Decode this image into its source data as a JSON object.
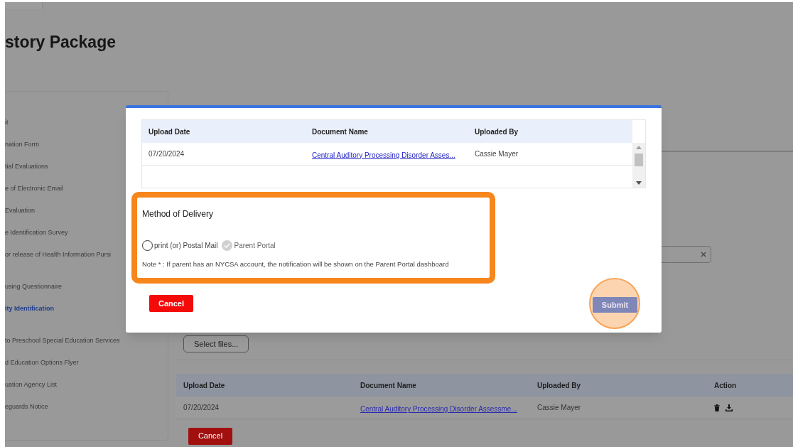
{
  "page": {
    "title": "story Package"
  },
  "sidebar": {
    "groups": [
      [
        {
          "label": "it",
          "selected": false
        },
        {
          "label": "nation Form",
          "selected": false
        },
        {
          "label": "tial Evaluations",
          "selected": false
        },
        {
          "label": "e of Electronic Email",
          "selected": false
        },
        {
          "label": "Evaluation",
          "selected": false
        },
        {
          "label": "e Identification Survey",
          "selected": false
        },
        {
          "label": "or release of Health Information Pursi",
          "selected": false
        }
      ],
      [
        {
          "label": "using Questionnaire",
          "selected": false
        },
        {
          "label": "ity Identification",
          "selected": true
        }
      ],
      [
        {
          "label": "to Preschool Special Education Services",
          "selected": false
        },
        {
          "label": "d Education Options Flyer",
          "selected": false
        },
        {
          "label": "uation Agency List",
          "selected": false
        },
        {
          "label": "eguards Notice",
          "selected": false
        }
      ]
    ]
  },
  "upload": {
    "select_button": "Select files...",
    "table": {
      "columns": [
        "Upload Date",
        "Document Name",
        "Uploaded By",
        "Action"
      ],
      "rows": [
        {
          "date": "07/20/2024",
          "document": "Central Auditory Processing Disorder Assessme...",
          "uploaded_by": "Cassie Mayer"
        }
      ]
    },
    "cancel_button": "Cancel"
  },
  "modal": {
    "table": {
      "columns": [
        "Upload Date",
        "Document Name",
        "Uploaded By"
      ],
      "rows": [
        {
          "date": "07/20/2024",
          "document": "Central Auditory Processing Disorder Asses...",
          "uploaded_by": "Cassie Mayer"
        }
      ]
    },
    "delivery": {
      "title": "Method of Delivery",
      "options": [
        {
          "label": "print (or) Postal Mail",
          "checked": false,
          "disabled": false
        },
        {
          "label": "Parent Portal",
          "checked": true,
          "disabled": true
        }
      ],
      "note": "Note * : If parent has an NYCSA account, the notification will be shown on the Parent Portal dashboard"
    },
    "cancel_button": "Cancel",
    "submit_button": {
      "label": "Submit",
      "disabled": true
    }
  }
}
